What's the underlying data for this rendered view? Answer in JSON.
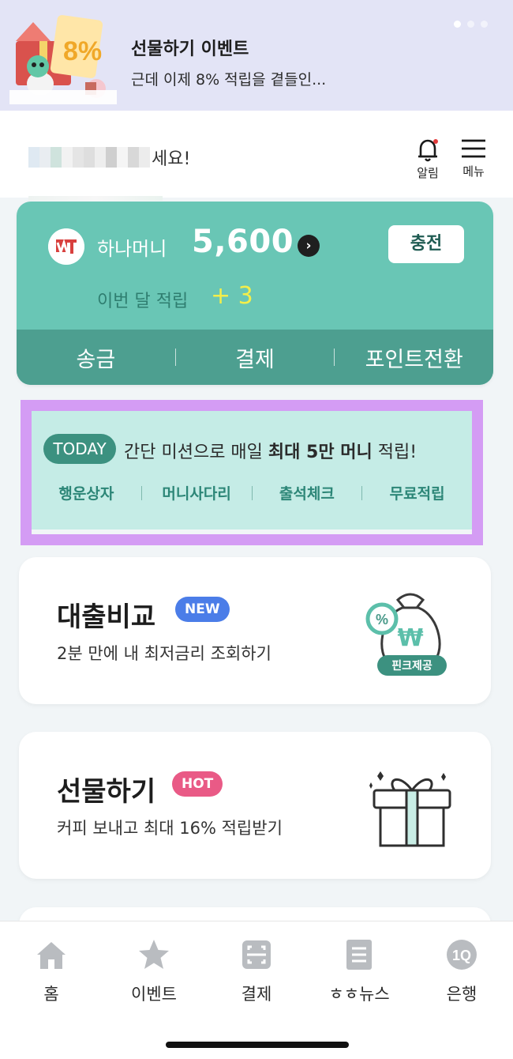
{
  "banner": {
    "title": "선물하기 이벤트",
    "subtitle": "근데 이제 8% 적립을 곁들인...",
    "badge_text": "8%",
    "page_dots": 3,
    "active_dot": 1
  },
  "header": {
    "greeting_visible": "세요!",
    "bell_label": "알림",
    "menu_label": "메뉴"
  },
  "money": {
    "label": "하나머니",
    "amount": "5,600",
    "arrow": "›",
    "charge_label": "충전",
    "month_label": "이번 달 적립",
    "month_value": "+ 3",
    "actions": [
      "송금",
      "결제",
      "포인트전환"
    ]
  },
  "today": {
    "badge": "TODAY",
    "text_prefix": "간단 미션으로 매일 ",
    "text_bold": "최대 5만 머니",
    "text_suffix": " 적립!",
    "links": [
      "행운상자",
      "머니사다리",
      "출석체크",
      "무료적립"
    ]
  },
  "services": {
    "loan": {
      "title": "대출비교",
      "badge": "NEW",
      "subtitle": "2분 만에 내 최저금리 조회하기",
      "tag": "핀크제공",
      "percent": "%",
      "won": "₩"
    },
    "gift": {
      "title": "선물하기",
      "badge": "HOT",
      "subtitle": "커피 보내고 최대 16% 적립받기"
    }
  },
  "nav": [
    {
      "label": "홈",
      "icon": "home-icon"
    },
    {
      "label": "이벤트",
      "icon": "star-icon"
    },
    {
      "label": "결제",
      "icon": "scan-icon"
    },
    {
      "label": "ㅎㅎ뉴스",
      "icon": "news-icon"
    },
    {
      "label": "은행",
      "icon": "bank-1q-icon",
      "icon_text": "1Q"
    }
  ],
  "colors": {
    "accent": "#69c6b5",
    "accent_dark": "#4d9f90",
    "highlight": "#d49cf4",
    "new_badge": "#4b7de8",
    "hot_badge": "#e95a86"
  }
}
